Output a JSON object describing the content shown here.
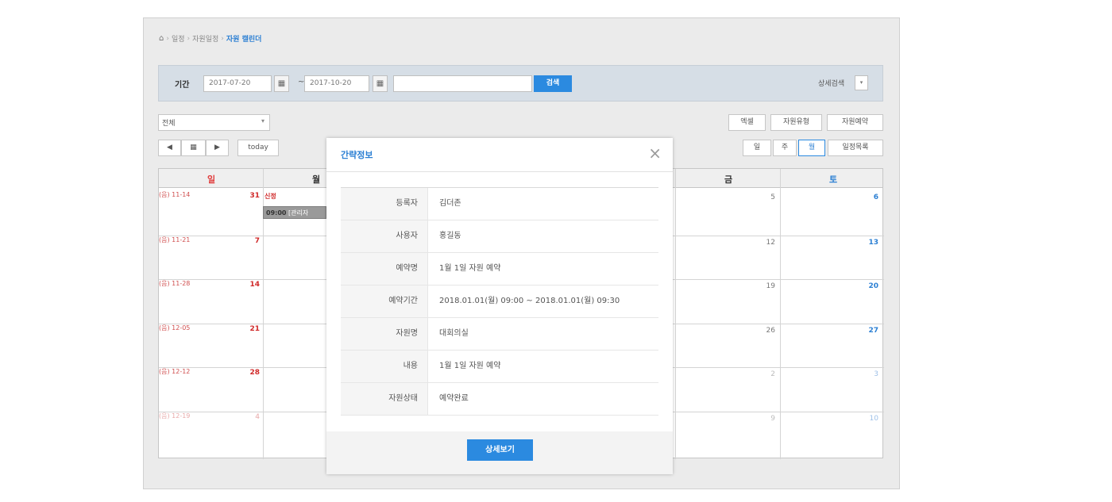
{
  "breadcrumb": {
    "items": [
      "일정",
      "자원일정"
    ],
    "current": "자원 캘린더"
  },
  "search": {
    "period_label": "기간",
    "start_date": "2017-07-20",
    "end_date": "2017-10-20",
    "range_sep": "~",
    "keyword": "",
    "search_label": "검색",
    "detail_search_label": "상세검색",
    "detail_toggle_icon": "▾"
  },
  "filter": {
    "selected": "전체",
    "arrow": "▾"
  },
  "actions": {
    "excel": "엑셀",
    "resource_type": "자원유형",
    "resource_booking": "자원예약"
  },
  "nav": {
    "prev": "◀",
    "calendar_icon": "▦",
    "next": "▶",
    "today": "today"
  },
  "views": {
    "day": "일",
    "week": "주",
    "month": "월",
    "list": "일정목록"
  },
  "calendar": {
    "weekdays": [
      "일",
      "월",
      "금",
      "토"
    ],
    "rows": [
      {
        "lunar": "(음) 11-14",
        "sun": "31",
        "fri": "5",
        "sat": "6",
        "faded_sun": false,
        "faded_end": false
      },
      {
        "lunar": "(음) 11-21",
        "sun": "7",
        "fri": "12",
        "sat": "13",
        "faded_sun": false,
        "faded_end": false
      },
      {
        "lunar": "(음) 11-28",
        "sun": "14",
        "fri": "19",
        "sat": "20",
        "faded_sun": false,
        "faded_end": false
      },
      {
        "lunar": "(음) 12-05",
        "sun": "21",
        "fri": "26",
        "sat": "27",
        "faded_sun": false,
        "faded_end": false
      },
      {
        "lunar": "(음) 12-12",
        "sun": "28",
        "fri": "2",
        "sat": "3",
        "faded_sun": false,
        "faded_end": true
      },
      {
        "lunar": "(음) 12-19",
        "sun": "4",
        "fri": "9",
        "sat": "10",
        "faded_sun": true,
        "faded_end": true
      }
    ],
    "holiday": "신정",
    "event": {
      "time": "09:00",
      "text": "[관리자"
    }
  },
  "modal": {
    "title": "간략정보",
    "close_icon": "×",
    "rows": [
      {
        "label": "등록자",
        "value": "김더존"
      },
      {
        "label": "사용자",
        "value": "홍길동"
      },
      {
        "label": "예약명",
        "value": "1월 1일 자원 예약"
      },
      {
        "label": "예약기간",
        "value": "2018.01.01(월) 09:00 ~ 2018.01.01(월) 09:30"
      },
      {
        "label": "자원명",
        "value": "대회의실"
      },
      {
        "label": "내용",
        "value": "1월 1일 자원 예약"
      },
      {
        "label": "자원상태",
        "value": "예약완료"
      }
    ],
    "detail_button": "상세보기"
  }
}
